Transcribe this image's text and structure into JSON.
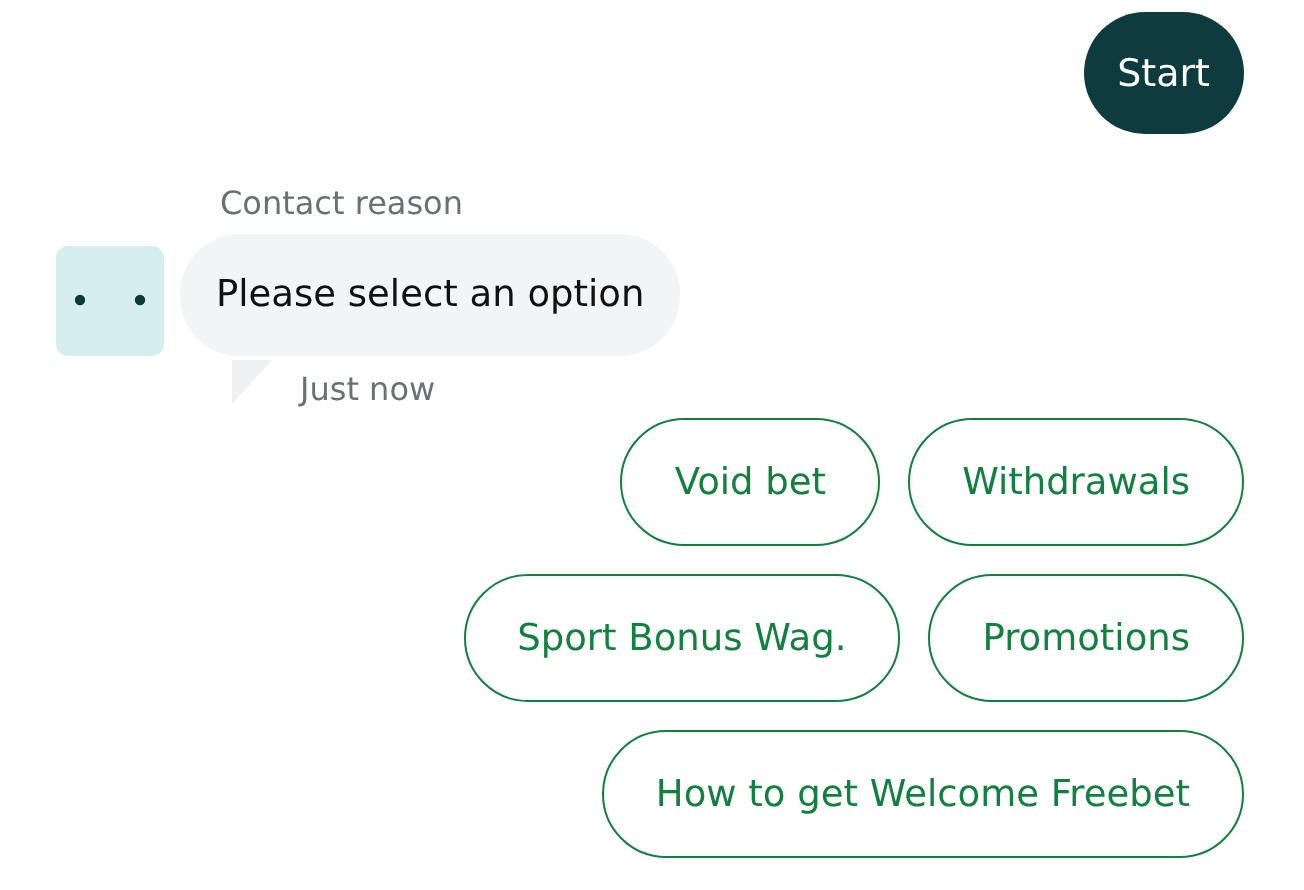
{
  "user_message": {
    "text": "Start"
  },
  "bot_message": {
    "sender_label": "Contact reason",
    "text": "Please select an option",
    "time": "Just now"
  },
  "options": [
    [
      "Void bet",
      "Withdrawals"
    ],
    [
      "Sport Bonus Wag.",
      "Promotions"
    ],
    [
      "How to get Welcome Freebet"
    ]
  ]
}
